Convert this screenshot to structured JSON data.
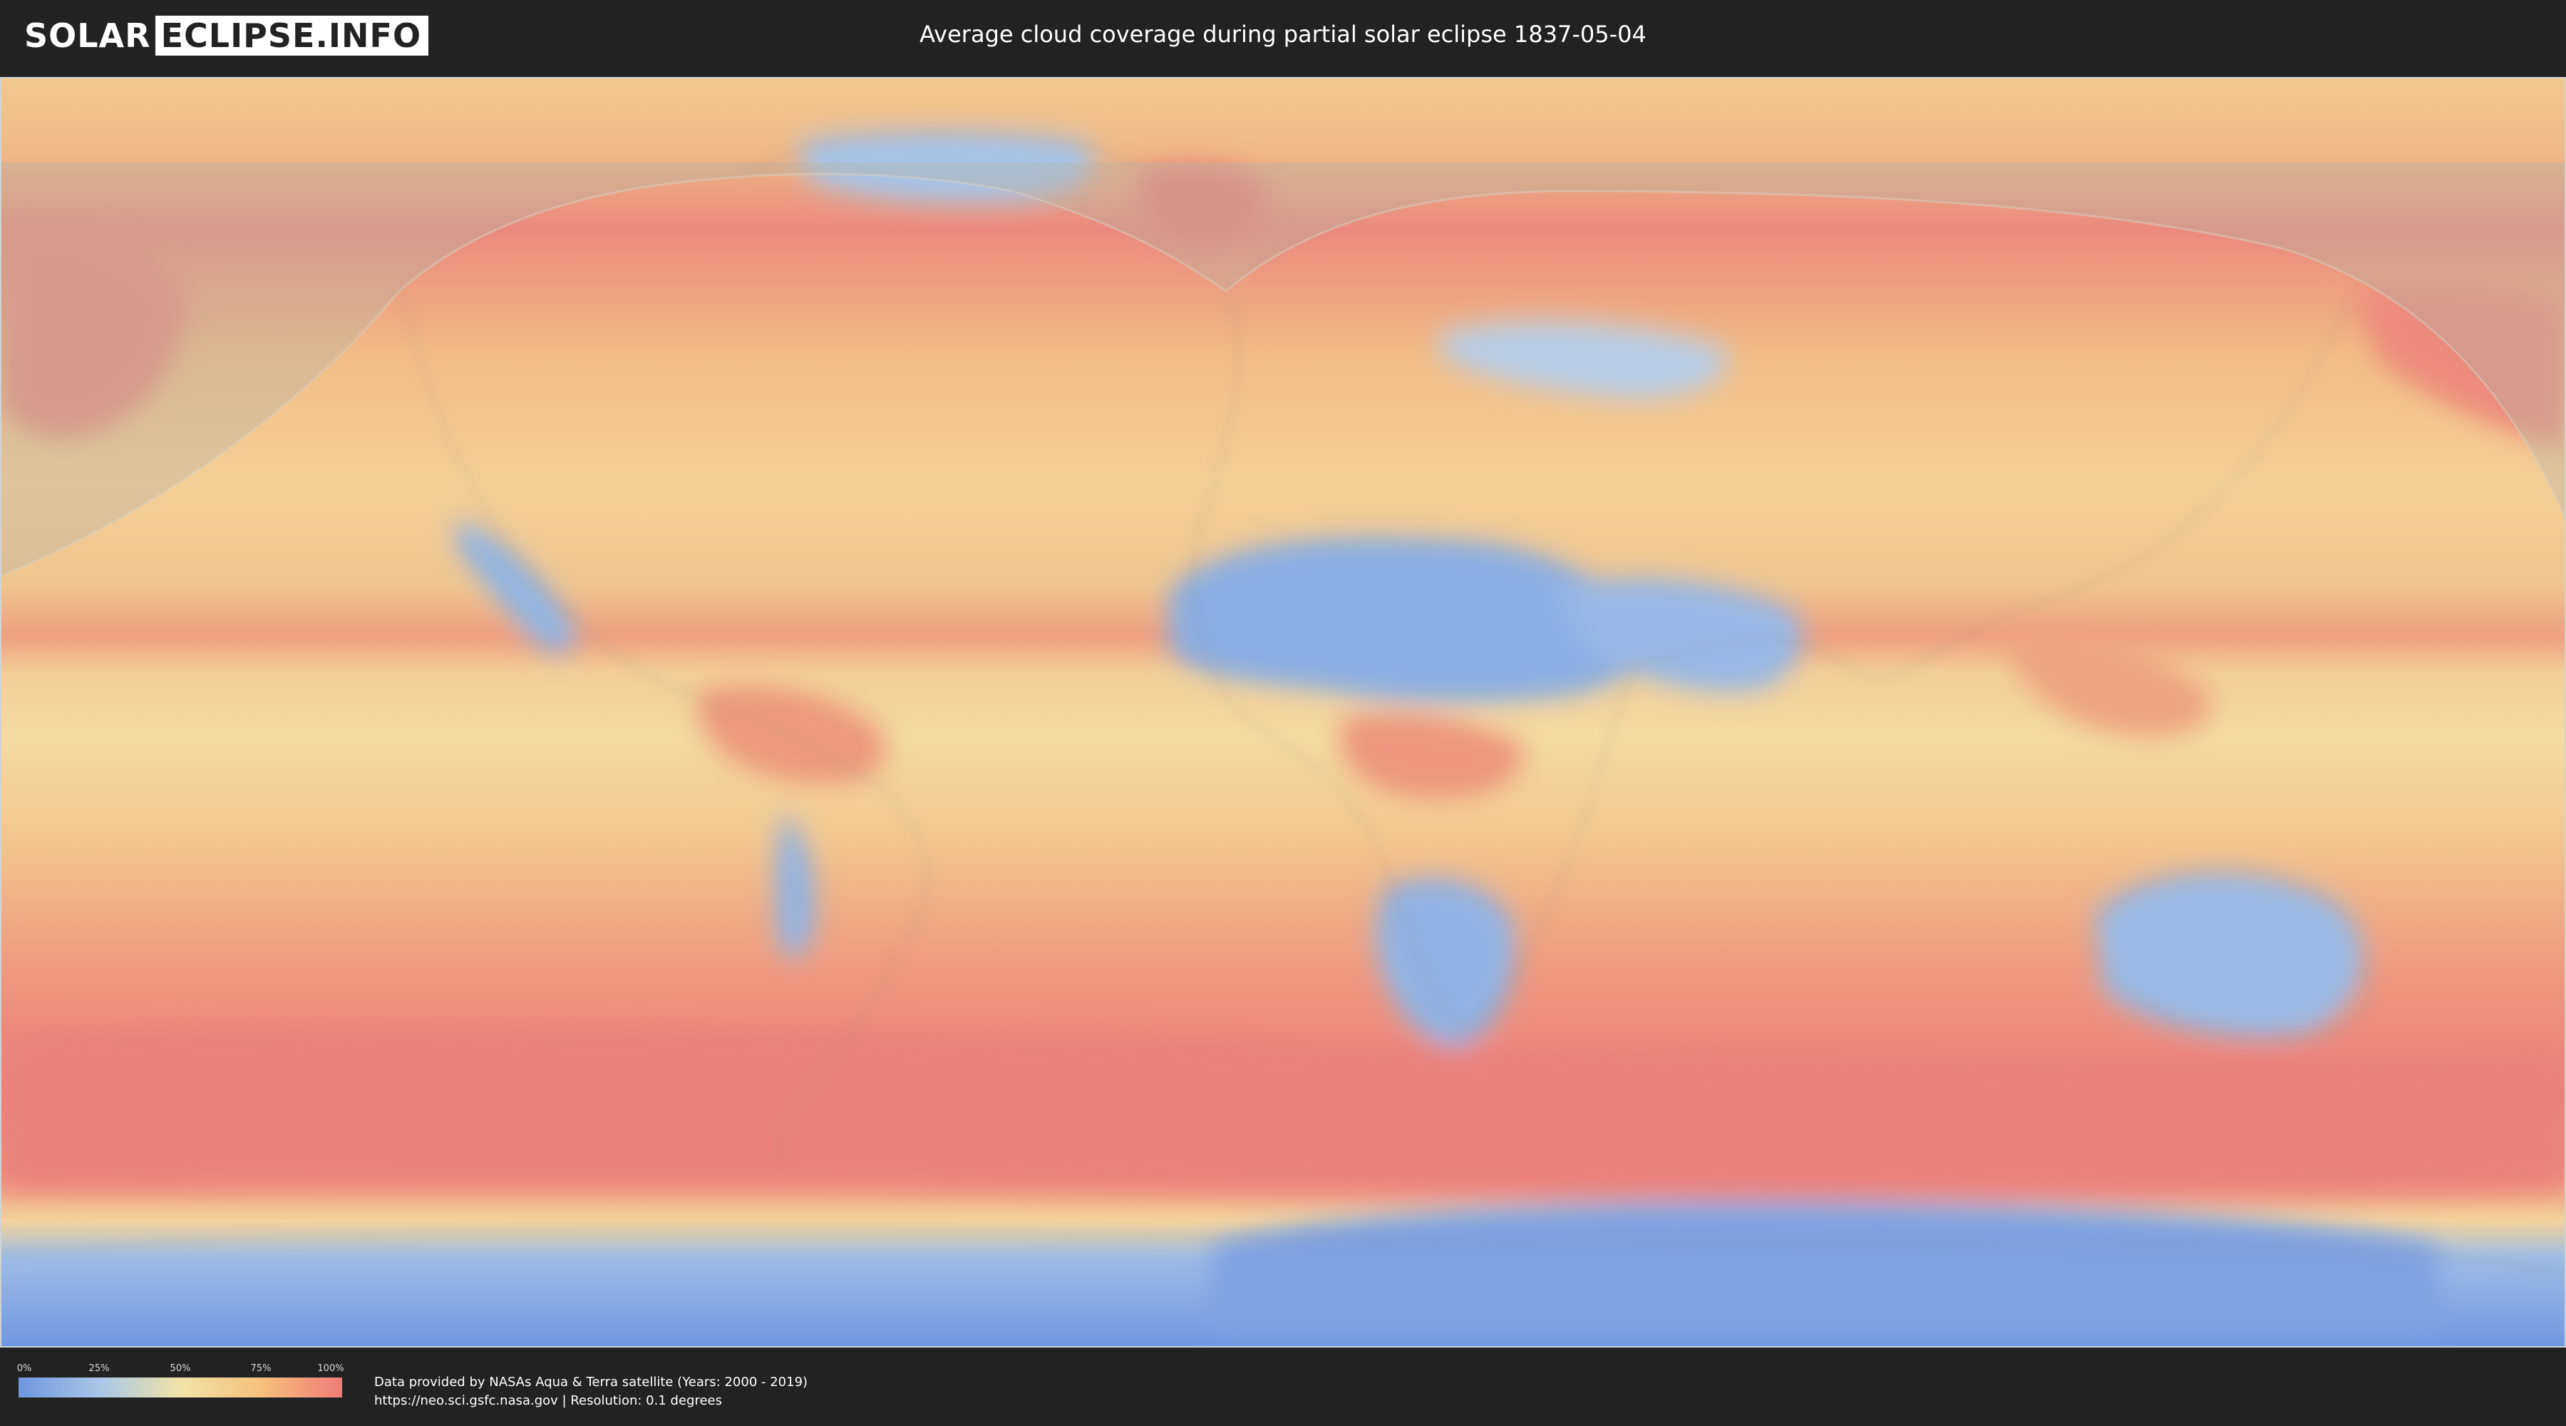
{
  "header": {
    "logo": {
      "part1": "SOLAR",
      "part2": "ECLIPSE.INFO"
    },
    "title": "Average cloud coverage during partial solar eclipse 1837-05-04"
  },
  "legend": {
    "ticks": [
      "0%",
      "25%",
      "50%",
      "75%",
      "100%"
    ],
    "gradient_colors": [
      "#6f97e0",
      "#a9c6e6",
      "#f1e4a8",
      "#f6c07c",
      "#ef7c78"
    ]
  },
  "credits": {
    "line1": "Data provided by NASAs Aqua & Terra satellite (Years: 2000 - 2019)",
    "line2": "https://neo.sci.gsfc.nasa.gov | Resolution: 0.1 degrees"
  },
  "colors": {
    "background": "#222222",
    "clear_sky": "#7fa3e0",
    "cloudy": "#ef7c78",
    "medium": "#f4d89c"
  }
}
